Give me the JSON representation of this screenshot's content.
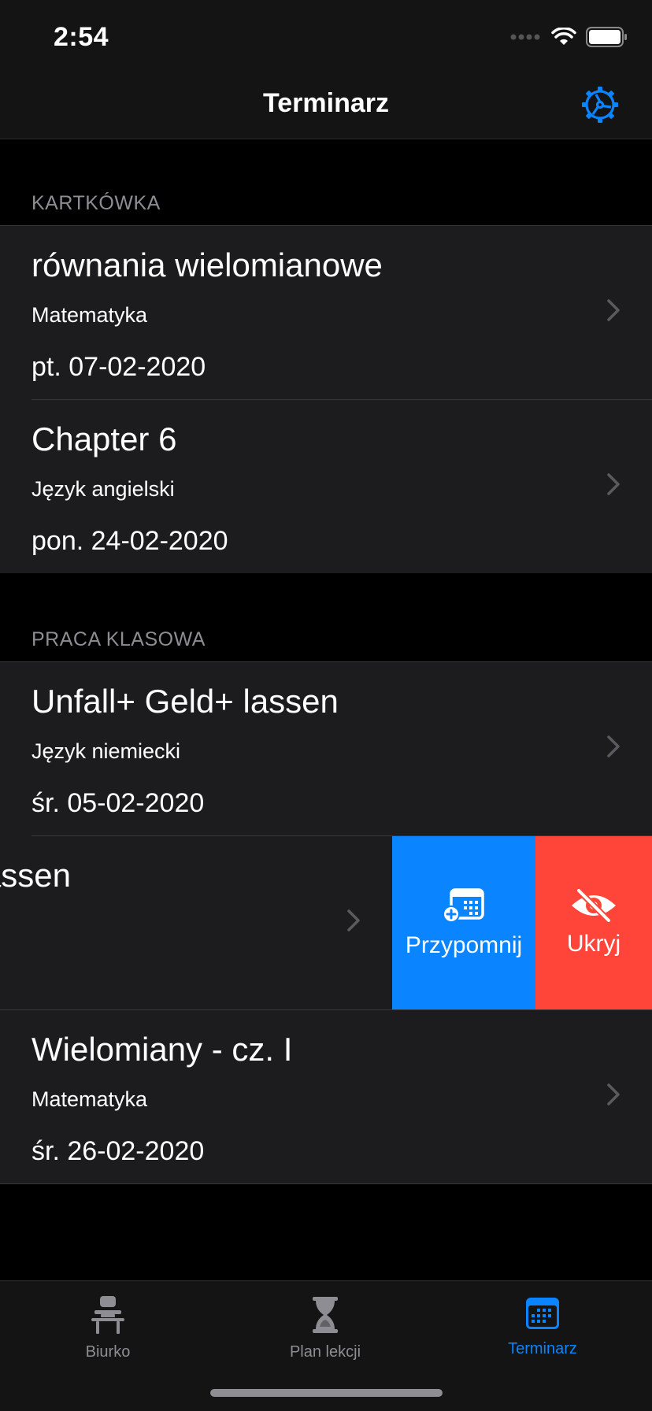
{
  "status_bar": {
    "time": "2:54"
  },
  "nav": {
    "title": "Terminarz",
    "settings_icon": "gear-icon"
  },
  "sections": [
    {
      "header": "KARTKÓWKA",
      "items": [
        {
          "title": "równania wielomianowe",
          "subject": "Matematyka",
          "date": "pt. 07-02-2020"
        },
        {
          "title": "Chapter 6",
          "subject": "Język angielski",
          "date": "pon. 24-02-2020"
        }
      ]
    },
    {
      "header": "PRACA KLASOWA",
      "items": [
        {
          "title": "Unfall+ Geld+ lassen",
          "subject": "Język niemiecki",
          "date": "śr. 05-02-2020"
        },
        {
          "title": "assen",
          "subject": "",
          "date": ""
        },
        {
          "title": "Wielomiany - cz. I",
          "subject": "Matematyka",
          "date": "śr. 26-02-2020"
        }
      ]
    }
  ],
  "swipe_actions": {
    "remind_label": "Przypomnij",
    "hide_label": "Ukryj"
  },
  "tabs": [
    {
      "label": "Biurko",
      "icon": "desk-icon",
      "active": false
    },
    {
      "label": "Plan lekcji",
      "icon": "hourglass-icon",
      "active": false
    },
    {
      "label": "Terminarz",
      "icon": "calendar-icon",
      "active": true
    }
  ],
  "colors": {
    "accent": "#0a84ff",
    "destructive": "#ff453a",
    "cell": "#1c1c1e",
    "secondary": "#8d8d93"
  }
}
